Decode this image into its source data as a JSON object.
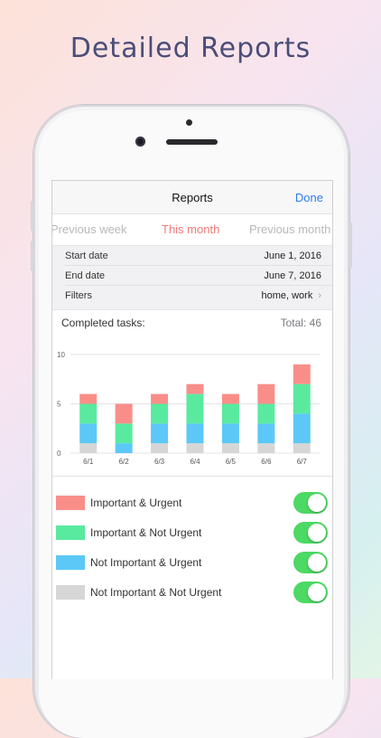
{
  "promo": {
    "headline": "Detailed Reports"
  },
  "navbar": {
    "title": "Reports",
    "done_label": "Done"
  },
  "periods": {
    "previous": "Previous week",
    "current": "This month",
    "next": "Previous month"
  },
  "info": {
    "start_label": "Start date",
    "start_value": "June 1, 2016",
    "end_label": "End date",
    "end_value": "June 7, 2016",
    "filters_label": "Filters",
    "filters_value": "home, work"
  },
  "tasks": {
    "heading": "Completed tasks:",
    "total": "Total: 46"
  },
  "chart_data": {
    "type": "bar",
    "stacked": true,
    "categories": [
      "6/1",
      "6/2",
      "6/3",
      "6/4",
      "6/5",
      "6/6",
      "6/7"
    ],
    "series": [
      {
        "name": "Not Important & Not Urgent",
        "color": "#d6d6d6",
        "values": [
          1,
          0,
          1,
          1,
          1,
          1,
          1
        ]
      },
      {
        "name": "Not Important & Urgent",
        "color": "#5cc8f7",
        "values": [
          2,
          1,
          2,
          2,
          2,
          2,
          3
        ]
      },
      {
        "name": "Important & Not Urgent",
        "color": "#59eaa0",
        "values": [
          2,
          2,
          2,
          3,
          2,
          2,
          3
        ]
      },
      {
        "name": "Important & Urgent",
        "color": "#f98e89",
        "values": [
          1,
          2,
          1,
          1,
          1,
          2,
          2
        ]
      }
    ],
    "yticks": [
      0,
      5,
      10
    ],
    "ylim": [
      0,
      10
    ],
    "grid": true
  },
  "legend": [
    {
      "label": "Important & Urgent",
      "color": "#f98e89",
      "enabled": true
    },
    {
      "label": "Important & Not Urgent",
      "color": "#59eaa0",
      "enabled": true
    },
    {
      "label": "Not Important & Urgent",
      "color": "#5cc8f7",
      "enabled": true
    },
    {
      "label": "Not Important & Not Urgent",
      "color": "#d6d6d6",
      "enabled": true
    }
  ],
  "colors": {
    "accent": "#2d7bf4",
    "current_period": "#f07a78",
    "toggle_on": "#4cd964"
  }
}
